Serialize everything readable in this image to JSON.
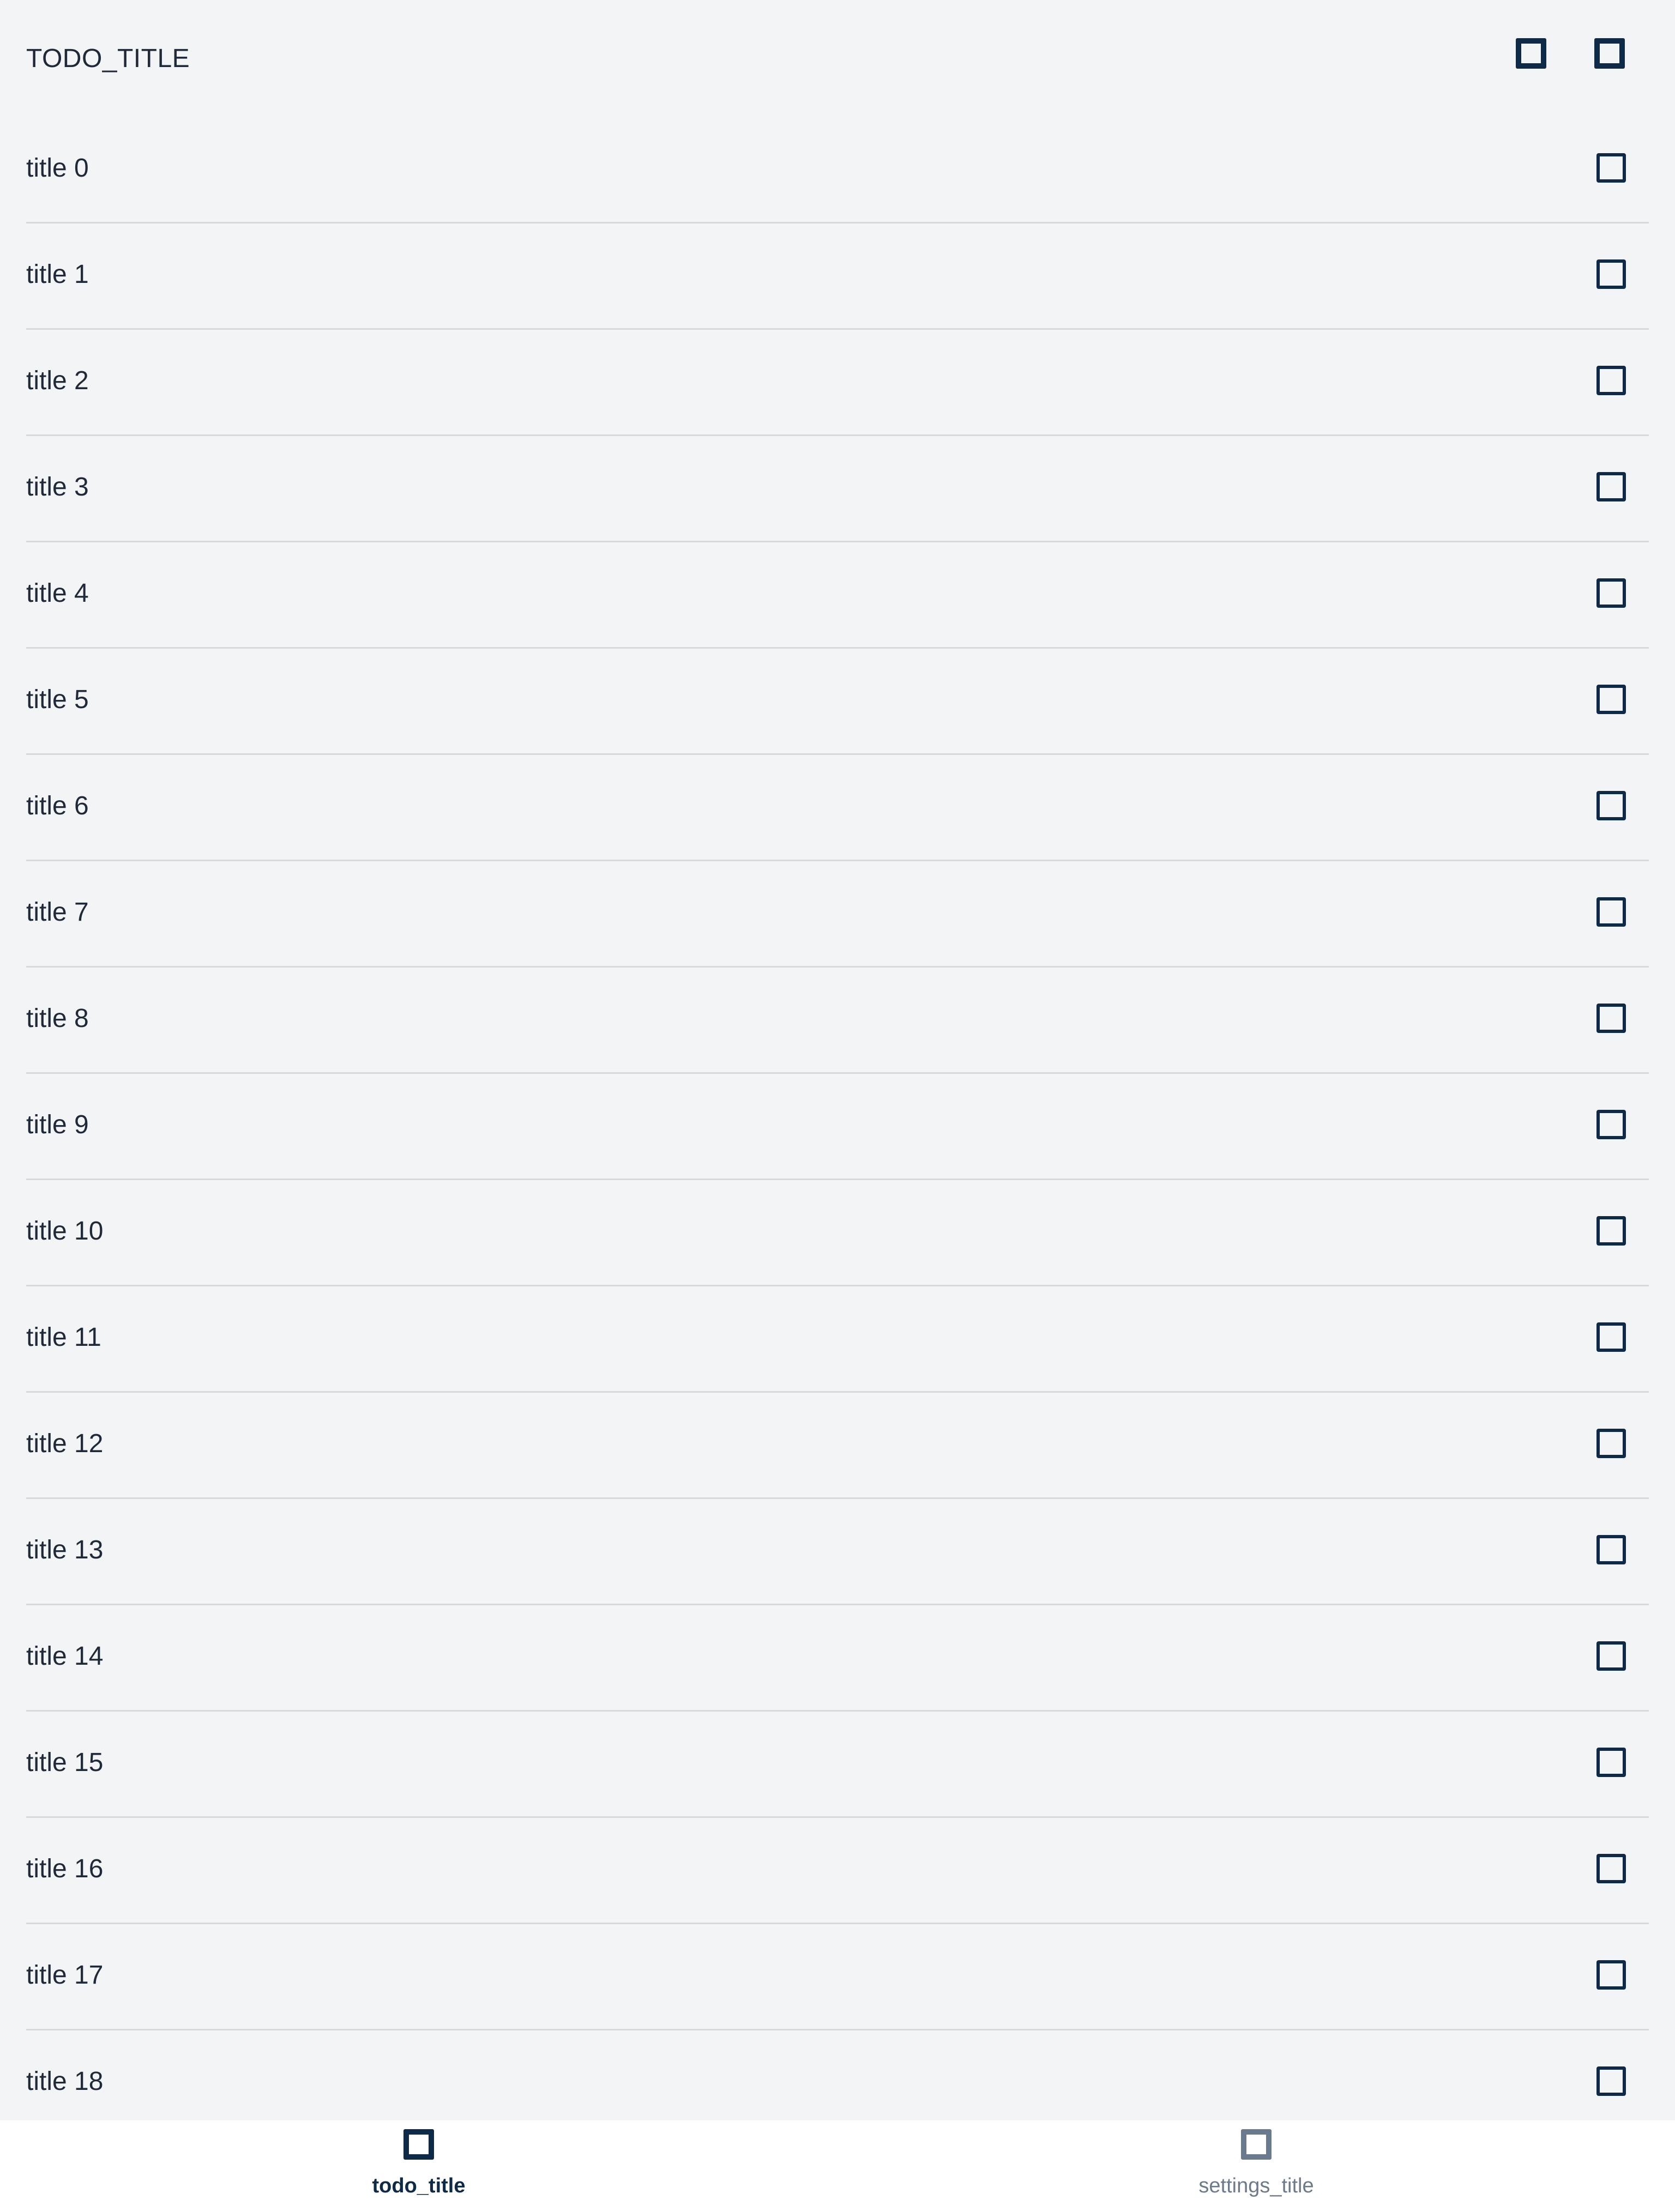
{
  "header": {
    "title": "TODO_TITLE",
    "actions": [
      {
        "icon": "square-icon"
      },
      {
        "icon": "square-icon"
      }
    ]
  },
  "todos": [
    {
      "title": "title 0",
      "checked": false
    },
    {
      "title": "title 1",
      "checked": false
    },
    {
      "title": "title 2",
      "checked": false
    },
    {
      "title": "title 3",
      "checked": false
    },
    {
      "title": "title 4",
      "checked": false
    },
    {
      "title": "title 5",
      "checked": false
    },
    {
      "title": "title 6",
      "checked": false
    },
    {
      "title": "title 7",
      "checked": false
    },
    {
      "title": "title 8",
      "checked": false
    },
    {
      "title": "title 9",
      "checked": false
    },
    {
      "title": "title 10",
      "checked": false
    },
    {
      "title": "title 11",
      "checked": false
    },
    {
      "title": "title 12",
      "checked": false
    },
    {
      "title": "title 13",
      "checked": false
    },
    {
      "title": "title 14",
      "checked": false
    },
    {
      "title": "title 15",
      "checked": false
    },
    {
      "title": "title 16",
      "checked": false
    },
    {
      "title": "title 17",
      "checked": false
    },
    {
      "title": "title 18",
      "checked": false
    }
  ],
  "bottom_nav": {
    "items": [
      {
        "label": "todo_title",
        "icon": "square-icon",
        "active": true
      },
      {
        "label": "settings_title",
        "icon": "square-icon",
        "active": false
      }
    ]
  },
  "colors": {
    "background": "#f3f4f6",
    "accent": "#0e2a47",
    "inactive": "#6b7a8c",
    "divider": "#d6d8dc",
    "nav_background": "#ffffff"
  }
}
